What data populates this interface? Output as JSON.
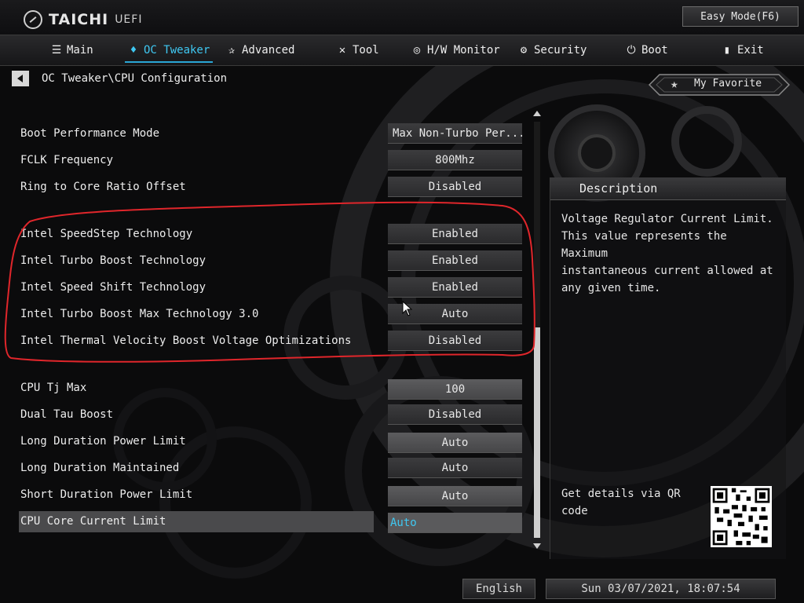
{
  "header": {
    "logo_text": "TAICHI",
    "logo_sub": "UEFI",
    "easy_mode": "Easy Mode(F6)"
  },
  "nav": {
    "items": [
      {
        "label": "Main",
        "icon": "list-icon"
      },
      {
        "label": "OC Tweaker",
        "icon": "flame-icon",
        "active": true
      },
      {
        "label": "Advanced",
        "icon": "star-icon"
      },
      {
        "label": "Tool",
        "icon": "tools-icon"
      },
      {
        "label": "H/W Monitor",
        "icon": "monitor-icon"
      },
      {
        "label": "Security",
        "icon": "shield-icon"
      },
      {
        "label": "Boot",
        "icon": "power-icon"
      },
      {
        "label": "Exit",
        "icon": "exit-icon"
      }
    ]
  },
  "breadcrumb": "OC Tweaker\\CPU Configuration",
  "favorite": "My Favorite",
  "settings": [
    {
      "label": "Boot Performance Mode",
      "value": "Max Non-Turbo Per..."
    },
    {
      "label": "FCLK Frequency",
      "value": "800Mhz"
    },
    {
      "label": "Ring to Core Ratio Offset",
      "value": "Disabled"
    },
    {
      "label": "Intel SpeedStep Technology",
      "value": "Enabled"
    },
    {
      "label": "Intel Turbo Boost Technology",
      "value": "Enabled"
    },
    {
      "label": "Intel Speed Shift Technology",
      "value": "Enabled"
    },
    {
      "label": "Intel Turbo Boost Max Technology 3.0",
      "value": "Auto"
    },
    {
      "label": "Intel Thermal Velocity Boost Voltage Optimizations",
      "value": "Disabled"
    },
    {
      "label": "CPU Tj Max",
      "value": "100"
    },
    {
      "label": "Dual Tau Boost",
      "value": "Disabled"
    },
    {
      "label": "Long Duration Power Limit",
      "value": "Auto"
    },
    {
      "label": "Long Duration Maintained",
      "value": "Auto"
    },
    {
      "label": "Short Duration Power Limit",
      "value": "Auto"
    },
    {
      "label": "CPU Core Current Limit",
      "value": "Auto",
      "selected": true
    }
  ],
  "description": {
    "title": "Description",
    "text": "Voltage Regulator Current Limit.\nThis value represents the Maximum\ninstantaneous current allowed at\nany given time.",
    "qr_text": "Get details via QR\ncode"
  },
  "footer": {
    "language": "English",
    "datetime": "Sun 03/07/2021, 18:07:54"
  },
  "colors": {
    "accent": "#3fc8f2",
    "annotation": "#e0262b"
  }
}
